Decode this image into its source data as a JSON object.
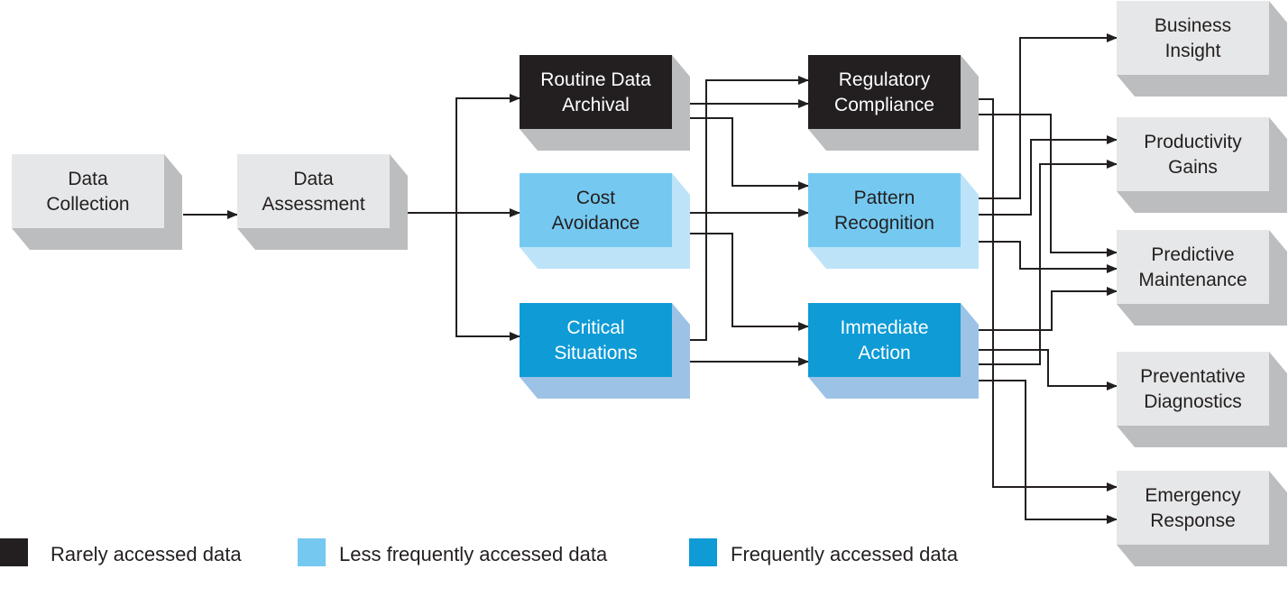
{
  "colors": {
    "rare": "#231f20",
    "rare_shadow": "#bcbdbf",
    "less": "#75c9f0",
    "less_shadow": "#bde3f8",
    "frequent": "#0e9bd6",
    "frequent_shadow": "#9cc3e6",
    "neutral": "#e6e7e8",
    "neutral_shadow": "#bcbdbf",
    "line": "#231f20"
  },
  "nodes": [
    {
      "id": "collection",
      "lines": [
        "Data",
        "Collection"
      ],
      "kind": "neutral"
    },
    {
      "id": "assessment",
      "lines": [
        "Data",
        "Assessment"
      ],
      "kind": "neutral"
    },
    {
      "id": "archival",
      "lines": [
        "Routine Data",
        "Archival"
      ],
      "kind": "rare"
    },
    {
      "id": "cost",
      "lines": [
        "Cost",
        "Avoidance"
      ],
      "kind": "less"
    },
    {
      "id": "critical",
      "lines": [
        "Critical",
        "Situations"
      ],
      "kind": "frequent"
    },
    {
      "id": "regulatory",
      "lines": [
        "Regulatory",
        "Compliance"
      ],
      "kind": "rare"
    },
    {
      "id": "pattern",
      "lines": [
        "Pattern",
        "Recognition"
      ],
      "kind": "less"
    },
    {
      "id": "immediate",
      "lines": [
        "Immediate",
        "Action"
      ],
      "kind": "frequent"
    },
    {
      "id": "insight",
      "lines": [
        "Business",
        "Insight"
      ],
      "kind": "neutral"
    },
    {
      "id": "productivity",
      "lines": [
        "Productivity",
        "Gains"
      ],
      "kind": "neutral"
    },
    {
      "id": "predictive",
      "lines": [
        "Predictive",
        "Maintenance"
      ],
      "kind": "neutral"
    },
    {
      "id": "preventative",
      "lines": [
        "Preventative",
        "Diagnostics"
      ],
      "kind": "neutral"
    },
    {
      "id": "emergency",
      "lines": [
        "Emergency",
        "Response"
      ],
      "kind": "neutral"
    }
  ],
  "edges": [
    {
      "from": "collection",
      "to": "assessment"
    },
    {
      "from": "assessment",
      "to": "archival"
    },
    {
      "from": "assessment",
      "to": "cost"
    },
    {
      "from": "assessment",
      "to": "critical"
    },
    {
      "from": "archival",
      "to": "regulatory"
    },
    {
      "from": "archival",
      "to": "pattern"
    },
    {
      "from": "cost",
      "to": "pattern"
    },
    {
      "from": "cost",
      "to": "immediate"
    },
    {
      "from": "critical",
      "to": "regulatory"
    },
    {
      "from": "critical",
      "to": "immediate"
    },
    {
      "from": "regulatory",
      "to": "emergency"
    },
    {
      "from": "regulatory",
      "to": "predictive"
    },
    {
      "from": "pattern",
      "to": "insight"
    },
    {
      "from": "pattern",
      "to": "productivity"
    },
    {
      "from": "pattern",
      "to": "predictive"
    },
    {
      "from": "immediate",
      "to": "predictive"
    },
    {
      "from": "immediate",
      "to": "preventative"
    },
    {
      "from": "immediate",
      "to": "productivity"
    },
    {
      "from": "immediate",
      "to": "emergency"
    }
  ],
  "legend": [
    {
      "label": "Rarely accessed data",
      "kind": "rare"
    },
    {
      "label": "Less frequently accessed data",
      "kind": "less"
    },
    {
      "label": "Frequently accessed data",
      "kind": "frequent"
    }
  ]
}
